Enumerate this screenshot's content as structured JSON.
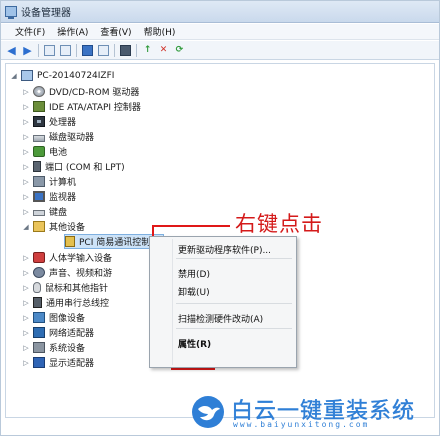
{
  "window": {
    "title": "设备管理器"
  },
  "menu": [
    "文件(F)",
    "操作(A)",
    "查看(V)",
    "帮助(H)"
  ],
  "toolbar_icons": [
    "back-arrow-icon",
    "forward-arrow-icon",
    "properties-icon",
    "grid-icon",
    "help-icon",
    "view-icon",
    "monitor-icon",
    "update-driver-icon",
    "scan-icon",
    "disable-icon",
    "uninstall-icon"
  ],
  "tree": {
    "root": "PC-20140724IZFI",
    "items": [
      "DVD/CD-ROM 驱动器",
      "IDE ATA/ATAPI 控制器",
      "处理器",
      "磁盘驱动器",
      "电池",
      "端口 (COM 和 LPT)",
      "计算机",
      "监视器",
      "键盘",
      "其他设备",
      "PCI 简易通讯控制器",
      "人体学输入设备",
      "声音、视频和游",
      "鼠标和其他指针",
      "通用串行总线控",
      "图像设备",
      "网络适配器",
      "系统设备",
      "显示适配器"
    ]
  },
  "annotation": {
    "text": "右键点击",
    "color": "#e01818"
  },
  "context_menu": {
    "items": [
      "更新驱动程序软件(P)...",
      "禁用(D)",
      "卸载(U)",
      "扫描检测硬件改动(A)",
      "属性(R)"
    ]
  },
  "watermark": {
    "title": "白云一键重装系统",
    "url": "www.baiyunxitong.com",
    "color": "#2f7fd6"
  }
}
